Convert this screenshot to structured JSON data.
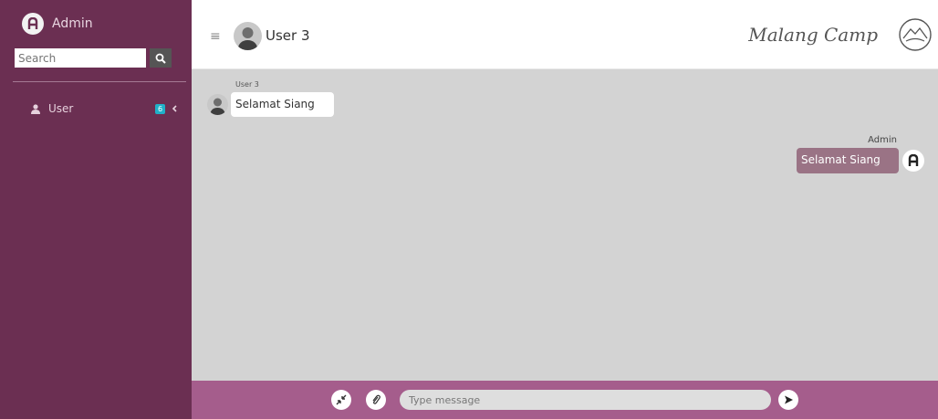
{
  "sidebar": {
    "brand_name": "Admin",
    "search_placeholder": "Search",
    "nav": [
      {
        "label": "User",
        "badge": "6",
        "icon": "user-icon"
      }
    ]
  },
  "header": {
    "menu_icon": "hamburger-icon",
    "username": "User 3",
    "camp_title": "Malang Camp",
    "camp_logo": "mountain-logo"
  },
  "messages": [
    {
      "direction": "incoming",
      "sender": "User 3",
      "text": "Selamat Siang"
    },
    {
      "direction": "outgoing",
      "sender": "Admin",
      "text": "Selamat Siang"
    }
  ],
  "composer": {
    "placeholder": "Type message",
    "minimize_icon": "compress-icon",
    "attach_icon": "paperclip-icon",
    "send_icon": "send-icon"
  },
  "colors": {
    "sidebar_bg": "#6b2f52",
    "chat_bg": "#d3d3d3",
    "composer_bg": "#a55d8c",
    "badge": "#20b0c8",
    "outgoing_bubble": "#9a7385"
  }
}
